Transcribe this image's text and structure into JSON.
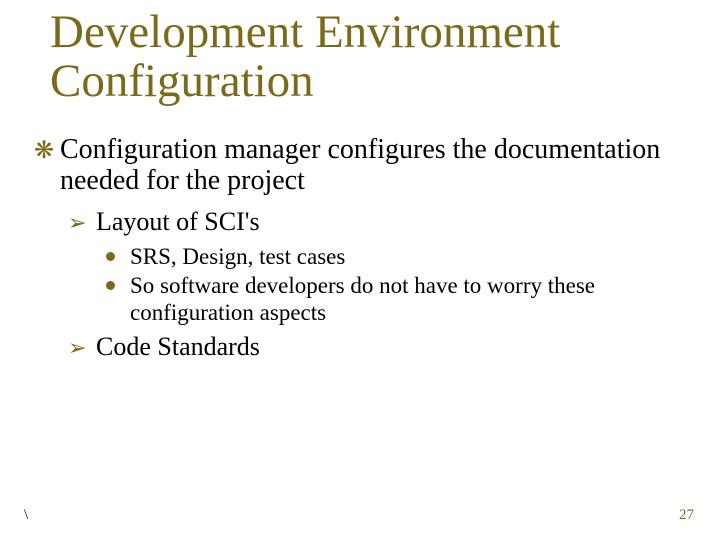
{
  "title": "Development Environment Configuration",
  "bullets": {
    "l1_1": "Configuration manager configures the documentation needed for the project",
    "l2_1": "Layout of SCI's",
    "l3_1": "SRS, Design, test cases",
    "l3_2": "So software developers do not have to worry these configuration aspects",
    "l2_2": "Code Standards"
  },
  "glyphs": {
    "l1": "❋",
    "l2": "➢"
  },
  "footer": {
    "left": "\\",
    "page": "27"
  }
}
